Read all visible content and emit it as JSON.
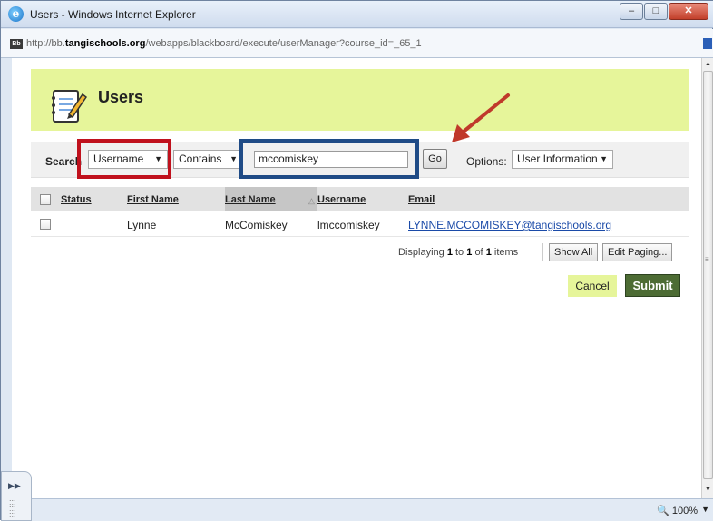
{
  "window": {
    "title": "Users - Windows Internet Explorer",
    "url_prefix": "http://bb.",
    "url_domain": "tangischools.org",
    "url_suffix": "/webapps/blackboard/execute/userManager?course_id=_65_1"
  },
  "page": {
    "title": "Users",
    "search": {
      "label": "Search",
      "field_value": "Username",
      "operator_value": "Contains",
      "query": "mccomiskey",
      "go_label": "Go",
      "options_label": "Options:",
      "options_value": "User Information"
    },
    "table": {
      "headers": [
        "Status",
        "First Name",
        "Last Name",
        "Username",
        "Email"
      ],
      "rows": [
        {
          "status": "",
          "first_name": "Lynne",
          "last_name": "McComiskey",
          "username": "lmccomiskey",
          "email": "LYNNE.MCCOMISKEY@tangischools.org"
        }
      ]
    },
    "paging": {
      "prefix": "Displaying",
      "from": "1",
      "to_word": "to",
      "to": "1",
      "of_word": "of",
      "total": "1",
      "suffix": "items",
      "show_all": "Show All",
      "edit_paging": "Edit Paging..."
    },
    "actions": {
      "cancel": "Cancel",
      "submit": "Submit"
    }
  },
  "statusbar": {
    "zoom": "100%"
  },
  "colors": {
    "highlight_red": "#c0111d",
    "highlight_blue": "#1f4b86",
    "arrow": "#c0392b",
    "header_band": "#e6f59a",
    "submit": "#4d6c34"
  }
}
